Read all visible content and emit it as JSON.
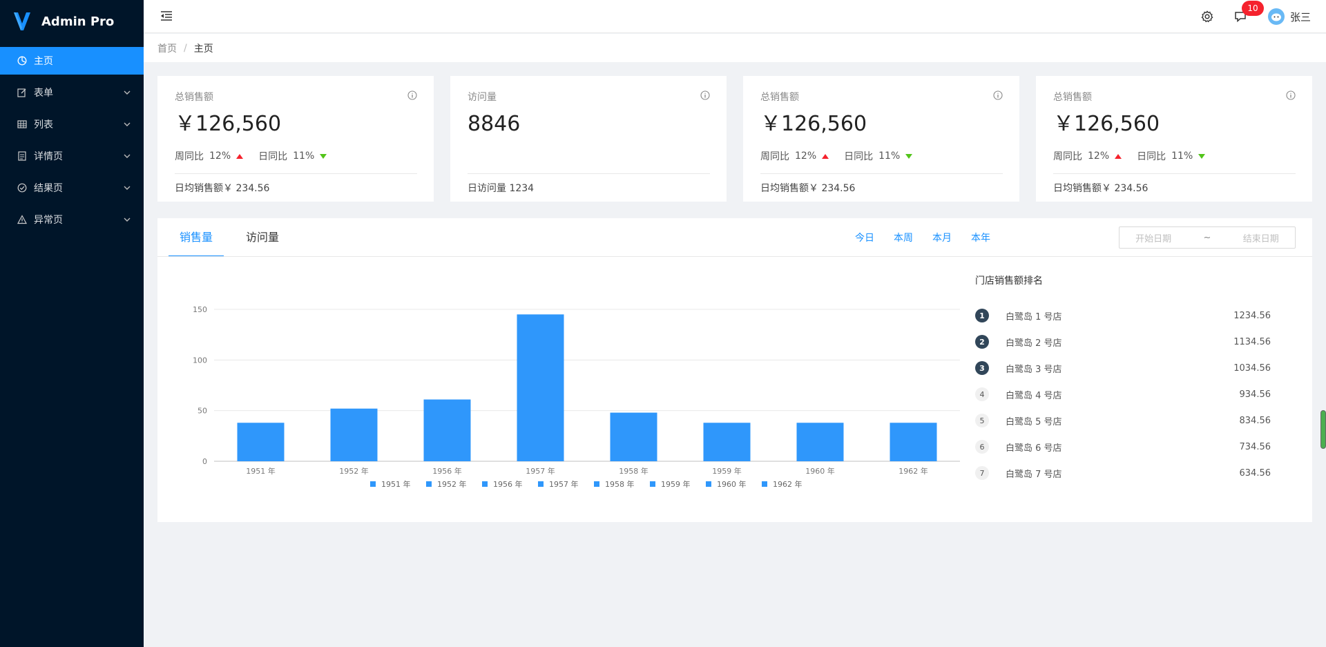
{
  "app": {
    "title": "Admin Pro"
  },
  "sidebar": {
    "items": [
      {
        "label": "主页",
        "icon": "dashboard-icon",
        "active": true,
        "has_children": false
      },
      {
        "label": "表单",
        "icon": "form-edit-icon",
        "active": false,
        "has_children": true
      },
      {
        "label": "列表",
        "icon": "table-icon",
        "active": false,
        "has_children": true
      },
      {
        "label": "详情页",
        "icon": "profile-icon",
        "active": false,
        "has_children": true
      },
      {
        "label": "结果页",
        "icon": "check-circle-icon",
        "active": false,
        "has_children": true
      },
      {
        "label": "异常页",
        "icon": "warning-icon",
        "active": false,
        "has_children": true
      }
    ]
  },
  "header": {
    "notification_count": "10",
    "username": "张三"
  },
  "breadcrumb": {
    "home": "首页",
    "separator": "/",
    "current": "主页"
  },
  "cards": [
    {
      "title": "总销售额",
      "value": "￥126,560",
      "trend": {
        "week_label": "周同比",
        "week_value": "12%",
        "day_label": "日同比",
        "day_value": "11%"
      },
      "footer": "日均销售额￥ 234.56"
    },
    {
      "title": "访问量",
      "value": "8846",
      "footer": "日访问量 1234"
    },
    {
      "title": "总销售额",
      "value": "￥126,560",
      "trend": {
        "week_label": "周同比",
        "week_value": "12%",
        "day_label": "日同比",
        "day_value": "11%"
      },
      "footer": "日均销售额￥ 234.56"
    },
    {
      "title": "总销售额",
      "value": "￥126,560",
      "trend": {
        "week_label": "周同比",
        "week_value": "12%",
        "day_label": "日同比",
        "day_value": "11%"
      },
      "footer": "日均销售额￥ 234.56"
    }
  ],
  "panel": {
    "tabs": [
      "销售量",
      "访问量"
    ],
    "ranges": [
      "今日",
      "本周",
      "本月",
      "本年"
    ],
    "date_start_placeholder": "开始日期",
    "date_sep": "~",
    "date_end_placeholder": "结束日期",
    "rank_title": "门店销售额排名",
    "rank": [
      {
        "num": "1",
        "name": "白鹭岛 1 号店",
        "value": "1234.56"
      },
      {
        "num": "2",
        "name": "白鹭岛 2 号店",
        "value": "1134.56"
      },
      {
        "num": "3",
        "name": "白鹭岛 3 号店",
        "value": "1034.56"
      },
      {
        "num": "4",
        "name": "白鹭岛 4 号店",
        "value": "934.56"
      },
      {
        "num": "5",
        "name": "白鹭岛 5 号店",
        "value": "834.56"
      },
      {
        "num": "6",
        "name": "白鹭岛 6 号店",
        "value": "734.56"
      },
      {
        "num": "7",
        "name": "白鹭岛 7 号店",
        "value": "634.56"
      }
    ]
  },
  "colors": {
    "primary": "#1890ff",
    "sidebar_bg": "#001529",
    "bar": "#2f97fb",
    "up": "#f5222d",
    "down": "#52c41a"
  },
  "chart_data": {
    "type": "bar",
    "categories": [
      "1951 年",
      "1952 年",
      "1956 年",
      "1957 年",
      "1958 年",
      "1959 年",
      "1960 年",
      "1962 年"
    ],
    "values": [
      38,
      52,
      61,
      145,
      48,
      38,
      38,
      38
    ],
    "ylim": [
      0,
      150
    ],
    "yticks": [
      0,
      50,
      100,
      150
    ],
    "grid": true,
    "legend": "bottom",
    "legend_entries": [
      "1951 年",
      "1952 年",
      "1956 年",
      "1957 年",
      "1958 年",
      "1959 年",
      "1960 年",
      "1962 年"
    ]
  }
}
